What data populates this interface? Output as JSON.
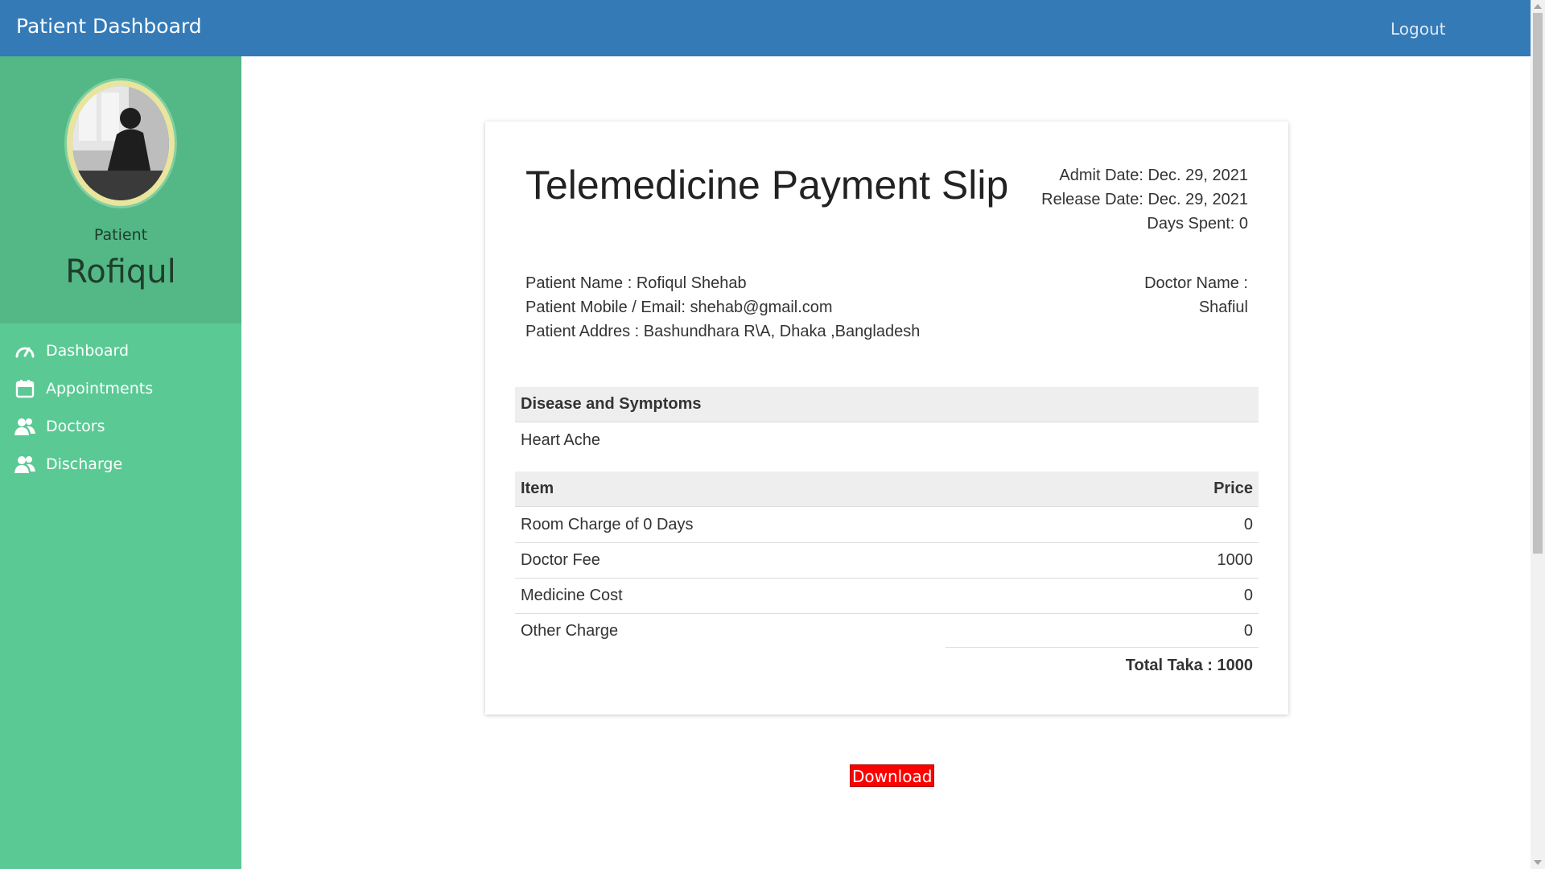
{
  "header": {
    "brand": "Patient Dashboard",
    "logout_label": "Logout"
  },
  "profile": {
    "role": "Patient",
    "name": "Rofiqul"
  },
  "sidebar": {
    "items": [
      {
        "label": "Dashboard",
        "icon": "speedometer-icon"
      },
      {
        "label": "Appointments",
        "icon": "calendar-icon"
      },
      {
        "label": "Doctors",
        "icon": "users-icon"
      },
      {
        "label": "Discharge",
        "icon": "users-icon"
      }
    ]
  },
  "slip": {
    "title": "Telemedicine Payment Slip",
    "admit_date": "Admit Date: Dec. 29, 2021",
    "release_date": "Release Date: Dec. 29, 2021",
    "days_spent": "Days Spent: 0",
    "patient_name": "Patient Name : Rofiqul Shehab",
    "patient_contact": "Patient Mobile / Email: shehab@gmail.com",
    "patient_address": "Patient Addres : Bashundhara R\\A, Dhaka ,Bangladesh",
    "doctor_label": "Doctor Name :",
    "doctor_name": "Shafiul",
    "symptoms_header": "Disease and Symptoms",
    "symptoms": "Heart Ache",
    "table_headers": {
      "item": "Item",
      "price": "Price"
    },
    "charges": [
      {
        "item": "Room Charge of 0 Days",
        "price": "0"
      },
      {
        "item": "Doctor Fee",
        "price": "1000"
      },
      {
        "item": "Medicine Cost",
        "price": "0"
      },
      {
        "item": "Other Charge",
        "price": "0"
      }
    ],
    "total": "Total Taka : 1000"
  },
  "download_label": "Download",
  "colors": {
    "topbar": "#337ab7",
    "sidebar": "#5ac994",
    "profile_panel": "#53b886",
    "download_button": "#ff0000"
  }
}
